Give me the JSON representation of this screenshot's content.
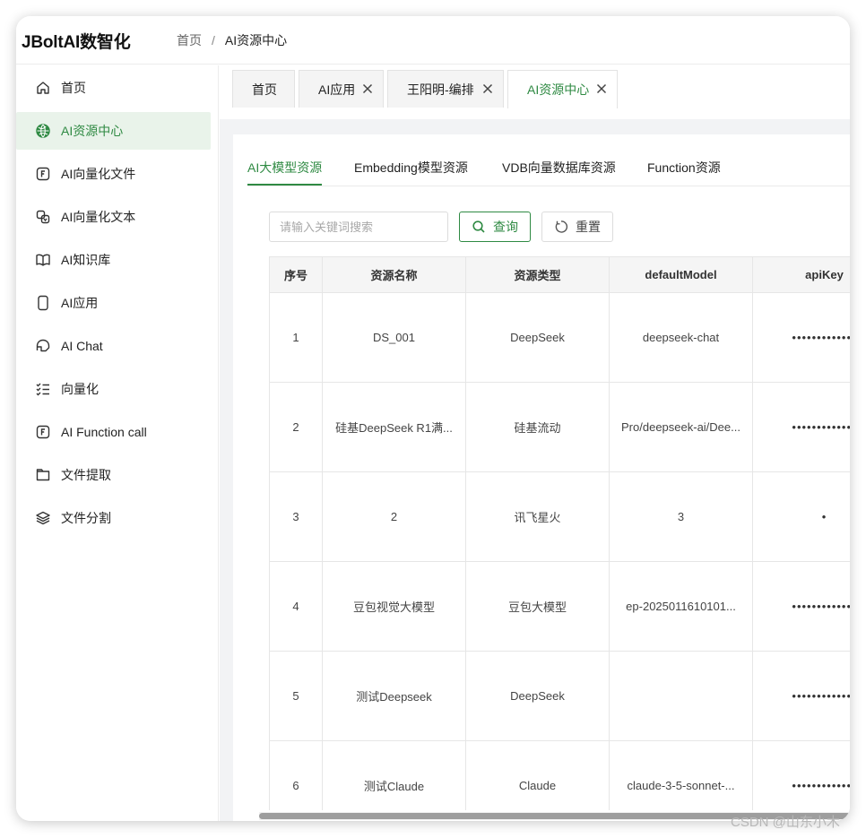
{
  "app": {
    "logo": "JBoltAI数智化"
  },
  "breadcrumb": {
    "home": "首页",
    "separator": "/",
    "current": "AI资源中心"
  },
  "sidebar": {
    "items": [
      {
        "label": "首页",
        "icon": "home-icon",
        "active": false
      },
      {
        "label": "AI资源中心",
        "icon": "globe-icon",
        "active": true
      },
      {
        "label": "AI向量化文件",
        "icon": "function-file-icon",
        "active": false
      },
      {
        "label": "AI向量化文本",
        "icon": "text-transform-icon",
        "active": false
      },
      {
        "label": "AI知识库",
        "icon": "book-icon",
        "active": false
      },
      {
        "label": "AI应用",
        "icon": "mobile-icon",
        "active": false
      },
      {
        "label": "AI Chat",
        "icon": "headset-icon",
        "active": false
      },
      {
        "label": "向量化",
        "icon": "list-check-icon",
        "active": false
      },
      {
        "label": "AI Function call",
        "icon": "function-file-icon",
        "active": false
      },
      {
        "label": "文件提取",
        "icon": "folder-icon",
        "active": false
      },
      {
        "label": "文件分割",
        "icon": "layers-icon",
        "active": false
      }
    ]
  },
  "tabs": [
    {
      "label": "首页",
      "closable": false,
      "active": false
    },
    {
      "label": "AI应用",
      "closable": true,
      "active": false
    },
    {
      "label": "王阳明-编排",
      "closable": true,
      "active": false
    },
    {
      "label": "AI资源中心",
      "closable": true,
      "active": true
    }
  ],
  "subtabs": [
    {
      "label": "AI大模型资源",
      "active": true
    },
    {
      "label": "Embedding模型资源",
      "active": false
    },
    {
      "label": "VDB向量数据库资源",
      "active": false
    },
    {
      "label": "Function资源",
      "active": false
    }
  ],
  "search": {
    "placeholder": "请输入关键词搜索",
    "value": "",
    "query_label": "查询",
    "reset_label": "重置"
  },
  "table": {
    "columns": [
      "序号",
      "资源名称",
      "资源类型",
      "defaultModel",
      "apiKey"
    ],
    "rows": [
      [
        "1",
        "DS_001",
        "DeepSeek",
        "deepseek-chat",
        "•••••••••••••"
      ],
      [
        "2",
        "硅基DeepSeek R1满...",
        "硅基流动",
        "Pro/deepseek-ai/Dee...",
        "•••••••••••••"
      ],
      [
        "3",
        "2",
        "讯飞星火",
        "3",
        "•"
      ],
      [
        "4",
        "豆包视觉大模型",
        "豆包大模型",
        "ep-2025011610101...",
        "•••••••••••••"
      ],
      [
        "5",
        "测试Deepseek",
        "DeepSeek",
        "",
        "•••••••••••••"
      ],
      [
        "6",
        "测试Claude",
        "Claude",
        "claude-3-5-sonnet-...",
        "•••••••••••••"
      ]
    ]
  },
  "watermark": "CSDN @山东小木",
  "colors": {
    "accent": "#2f8a43",
    "active_bg": "#e9f3ea"
  }
}
